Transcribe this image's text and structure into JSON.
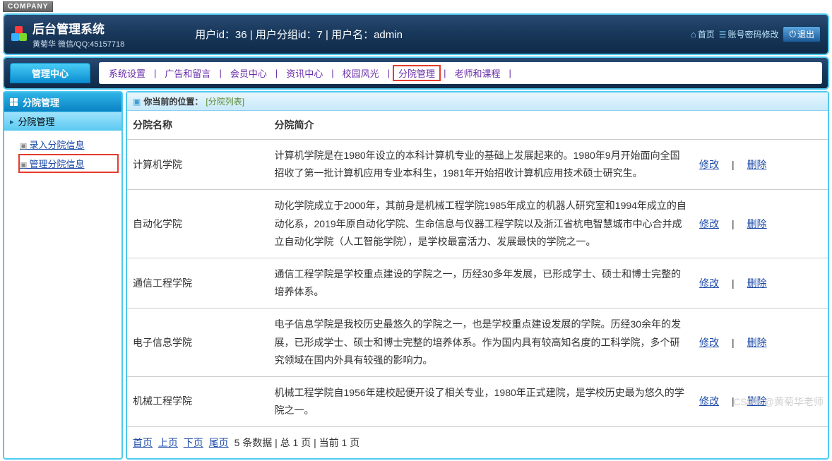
{
  "company_tag": "COMPANY",
  "header": {
    "title": "后台管理系统",
    "subtitle": "黄菊华 微信/QQ:45157718",
    "center": "用户id：36 | 用户分组id：7 | 用户名：admin",
    "home": "首页",
    "account": "账号密码修改",
    "logout": "退出"
  },
  "mgmt_center": "管理中心",
  "nav": {
    "items": [
      "系统设置",
      "广告和留言",
      "会员中心",
      "资讯中心",
      "校园风光",
      "分院管理",
      "老师和课程"
    ],
    "active_index": 5,
    "sep": "|"
  },
  "sidebar": {
    "head": "分院管理",
    "section": "分院管理",
    "links": [
      "录入分院信息",
      "管理分院信息"
    ],
    "highlighted_index": 1
  },
  "breadcrumb": {
    "prefix": "你当前的位置：",
    "loc": "[分院列表]"
  },
  "table": {
    "headers": {
      "name": "分院名称",
      "desc": "分院简介"
    },
    "rows": [
      {
        "name": "计算机学院",
        "desc": "计算机学院是在1980年设立的本科计算机专业的基础上发展起来的。1980年9月开始面向全国招收了第一批计算机应用专业本科生，1981年开始招收计算机应用技术硕士研究生。"
      },
      {
        "name": "自动化学院",
        "desc": "动化学院成立于2000年，其前身是机械工程学院1985年成立的机器人研究室和1994年成立的自动化系，2019年原自动化学院、生命信息与仪器工程学院以及浙江省杭电智慧城市中心合并成立自动化学院（人工智能学院），是学校最富活力、发展最快的学院之一。"
      },
      {
        "name": "通信工程学院",
        "desc": "通信工程学院是学校重点建设的学院之一，历经30多年发展，已形成学士、硕士和博士完整的培养体系。"
      },
      {
        "name": "电子信息学院",
        "desc": "电子信息学院是我校历史最悠久的学院之一，也是学校重点建设发展的学院。历经30余年的发展，已形成学士、硕士和博士完整的培养体系。作为国内具有较高知名度的工科学院，多个研究领域在国内外具有较强的影响力。"
      },
      {
        "name": "机械工程学院",
        "desc": "机械工程学院自1956年建校起便开设了相关专业，1980年正式建院，是学校历史最为悠久的学院之一。"
      }
    ],
    "actions": {
      "edit": "修改",
      "delete": "删除",
      "sep": "|"
    }
  },
  "pager": {
    "first": "首页",
    "prev": "上页",
    "next": "下页",
    "last": "尾页",
    "info": "5 条数据 | 总 1 页 | 当前 1 页"
  },
  "watermark": "CSDN @黄菊华老师"
}
